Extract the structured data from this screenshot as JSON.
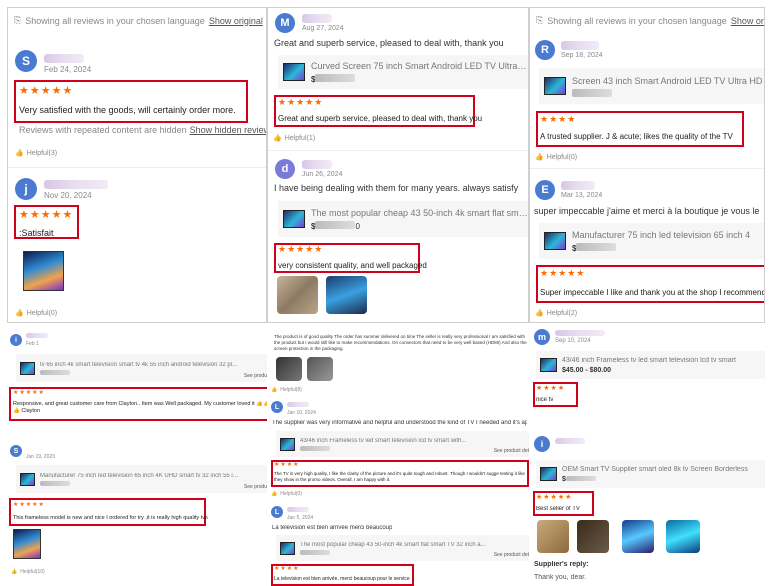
{
  "p1": {
    "lang_notice": "Showing all reviews in your chosen language",
    "show_original": "Show original",
    "r1": {
      "avatar": "S",
      "date": "Feb 24, 2024",
      "stars": "★★★★★",
      "text": "Very satisfied with the goods, will certainly order more."
    },
    "hidden_notice": "Reviews with repeated content are hidden",
    "show_hidden": "Show hidden reviews",
    "helpful1": "Helpful(3)",
    "r2": {
      "avatar": "j",
      "date": "Nov 20, 2024",
      "stars": "★★★★★",
      "text": ":Satisfait"
    },
    "helpful2": "Helpful(0)"
  },
  "p2": {
    "r1": {
      "avatar": "M",
      "date": "Aug 27, 2024",
      "text_top": "Great and superb service, pleased to deal with, thank you",
      "prod_title": "Curved Screen 75 inch Smart Android LED TV Ultra HD 4K",
      "price_prefix": "$",
      "stars": "★★★★★",
      "text": "Great and superb service, pleased to deal with, thank you"
    },
    "helpful1": "Helpful(1)",
    "r2": {
      "avatar": "d",
      "date": "Jun 26, 2024",
      "text_top": "I have being dealing with them for many years. always satisfy",
      "prod_title": "The most popular cheap 43 50-inch 4k smart flat smart TV",
      "price_prefix": "$",
      "price_suffix": "0",
      "stars": "★★★★★",
      "text": "very consistent quality, and well packaged"
    }
  },
  "p3": {
    "lang_notice": "Showing all reviews in your chosen language",
    "show_original": "Show original",
    "r1": {
      "avatar": "R",
      "date": "Sep 18, 2024",
      "prod_title": "Screen 43 inch Smart Android LED TV Ultra HD",
      "stars": "★★★★",
      "text": "A trusted supplier. J & acute; likes the quality of the TV"
    },
    "helpful1": "Helpful(0)",
    "r2": {
      "avatar": "E",
      "date": "Mar 13, 2024",
      "text_top": "super impeccable j'aime et merci à la boutique je vous le",
      "prod_title": "Manufacturer 75 inch led television 65 inch 4",
      "price_prefix": "$",
      "stars": "★★★★★",
      "text": "Super impeccable I like and thank you at the shop I recommend"
    },
    "helpful2": "Helpful(2)"
  },
  "p4": {
    "r1": {
      "avatar": "i",
      "date": "Feb 1",
      "prod_title": "tv 65 inch 4k smart television smart tv 4k 55 inch android television 32 pl...",
      "see_product": "See produ",
      "stars": "★★★★★",
      "text": "Responsive, and great customer care from Clayton.. Item was Well packaged. My customer loved it 👍👍👍 Clayton"
    },
    "r2": {
      "avatar": "S",
      "date": "Jan 19, 2023",
      "prod_title": "Manufacturer 75 inch led television 65 inch 4K UHD smart tv 32 inch 55 in...",
      "see_product": "See produ",
      "stars": "★★★★★",
      "text": "This frameless model is new and nice I ordered for try ,it is really high quality tvs"
    },
    "helpful": "Helpful(10)"
  },
  "p5": {
    "r0_text": "The product is of good quality The order has summer delivered on time The seller is really very professional I am satisfied with the product but I would still like to make recommendations. On connectors that need to be very well based (HDMI) And also the screen protection in the packaging.",
    "helpful0": "Helpful(8)",
    "r1": {
      "avatar": "L",
      "date": "Jan 10, 2024",
      "text_top": "The supplier was very informative and helpful and understood the kind of TV I needed and it's applic",
      "prod_title": "43/46 inch Frameless tv led smart television lcd tv smart with...",
      "see_product": "See product det",
      "stars": "★★★★",
      "text": "The TV is very high quality, I like the clarity of the picture and it's quite tough and robust. Though I wouldn't sugge testing it like they show in the promo videos. Overall, I am happy with it."
    },
    "helpful1": "Helpful(0)",
    "r2": {
      "avatar": "L",
      "date": "Jan 5, 2024",
      "text_top": "La television est bien arrivée merci beaucoup",
      "prod_title": "The most popular cheap 43 50-inch 4k smart flat smart TV 32 inch a...",
      "see_product": "See product det",
      "stars": "★★★★",
      "text": "La television est bien arrivée, merci beaucoup pour le service"
    }
  },
  "p6": {
    "r1": {
      "avatar": "m",
      "date": "Sep 10, 2024",
      "prod_title": "43/46 inch Frameless tv led smart television lcd tv smart",
      "price": "$45.00 - $80.00",
      "stars": "★★★★",
      "text": "nice tv"
    },
    "r2": {
      "avatar": "i",
      "prod_title": "OEM Smart TV Supplier smart oled 8k tv Screen Borderless",
      "price_prefix": "$",
      "stars": "★★★★★",
      "text": "Best seller of TV"
    },
    "supplier_reply": "Supplier's reply:",
    "reply_text": "Thank you, dear."
  },
  "colors": {
    "star": "#ff6a00",
    "highlight": "#d0021b",
    "avatar_blue": "#4a7bd0",
    "avatar_purple": "#7a4fd0"
  }
}
